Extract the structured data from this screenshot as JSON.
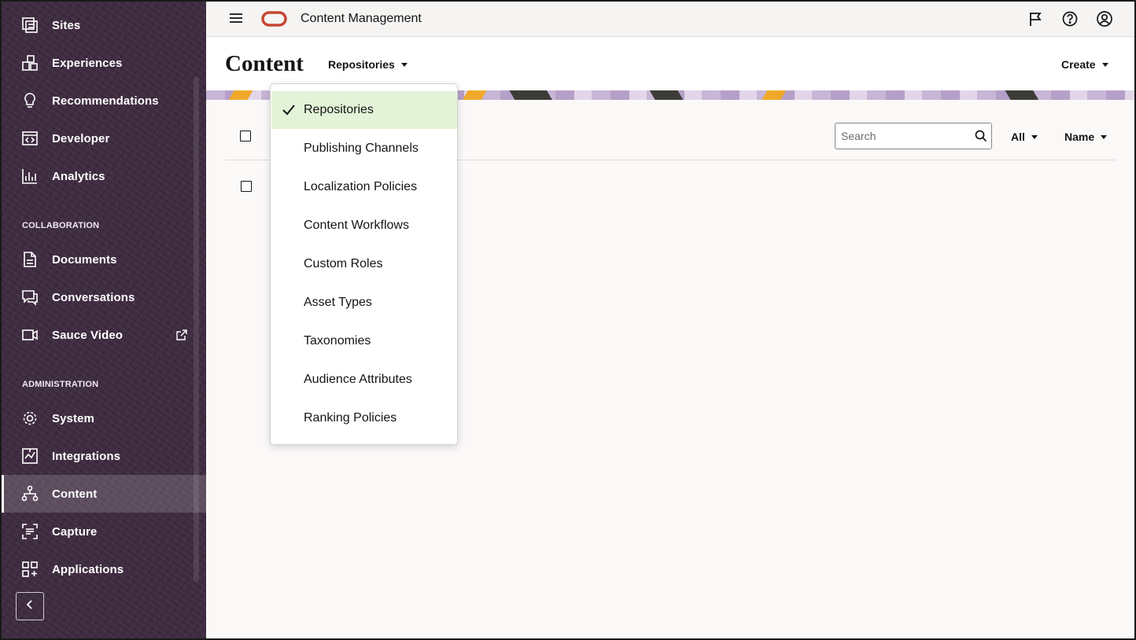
{
  "sidebar": {
    "items": [
      {
        "label": "Sites",
        "icon": "sites-icon"
      },
      {
        "label": "Experiences",
        "icon": "experiences-icon"
      },
      {
        "label": "Recommendations",
        "icon": "lightbulb-icon"
      },
      {
        "label": "Developer",
        "icon": "code-icon"
      },
      {
        "label": "Analytics",
        "icon": "bar-chart-icon"
      }
    ],
    "collaboration_header": "COLLABORATION",
    "collaboration_items": [
      {
        "label": "Documents",
        "icon": "document-icon"
      },
      {
        "label": "Conversations",
        "icon": "conversations-icon"
      },
      {
        "label": "Sauce Video",
        "icon": "video-camera-icon",
        "external": true
      }
    ],
    "administration_header": "ADMINISTRATION",
    "administration_items": [
      {
        "label": "System",
        "icon": "gear-icon"
      },
      {
        "label": "Integrations",
        "icon": "integrations-icon"
      },
      {
        "label": "Content",
        "icon": "content-hierarchy-icon",
        "active": true
      },
      {
        "label": "Capture",
        "icon": "capture-icon"
      },
      {
        "label": "Applications",
        "icon": "applications-grid-icon"
      }
    ]
  },
  "header": {
    "app_title": "Content Management",
    "logo": "oracle-logo",
    "icons": [
      "flag-icon",
      "help-icon",
      "user-avatar-icon"
    ]
  },
  "page": {
    "title": "Content",
    "selector_label": "Repositories",
    "create_label": "Create"
  },
  "toolbar": {
    "search_placeholder": "Search",
    "filter_label": "All",
    "sort_label": "Name"
  },
  "dropdown": {
    "selected": "Repositories",
    "options": [
      "Repositories",
      "Publishing Channels",
      "Localization Policies",
      "Content Workflows",
      "Custom Roles",
      "Asset Types",
      "Taxonomies",
      "Audience Attributes",
      "Ranking Policies"
    ]
  },
  "colors": {
    "sidebar_bg": "#3f2c41",
    "selected_option_bg": "#e3f3d8",
    "oracle_red": "#c74634"
  }
}
